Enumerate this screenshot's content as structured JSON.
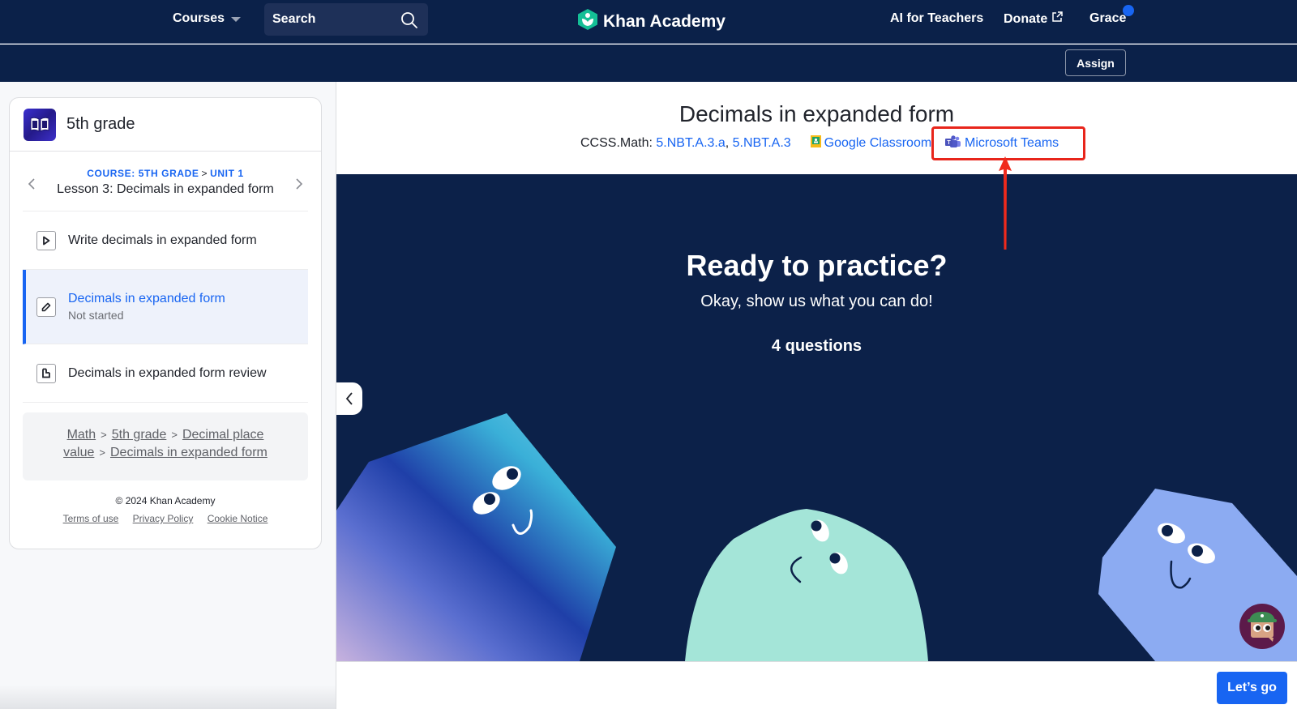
{
  "topnav": {
    "courses_label": "Courses",
    "search_placeholder": "Search",
    "logo_text": "Khan Academy",
    "ai_for_teachers": "AI for Teachers",
    "donate": "Donate",
    "user_name": "Grace",
    "notification_color": "#1865f2"
  },
  "subnav": {
    "assign_label": "Assign"
  },
  "sidebar": {
    "course_title": "5th grade",
    "lesson_crumb": {
      "course": "COURSE: 5TH GRADE",
      "separator": ">",
      "unit": "UNIT 1"
    },
    "lesson_title": "Lesson 3: Decimals in expanded form",
    "items": [
      {
        "label": "Write decimals in expanded form",
        "type": "video",
        "status": ""
      },
      {
        "label": "Decimals in expanded form",
        "type": "exercise",
        "status": "Not started",
        "active": true
      },
      {
        "label": "Decimals in expanded form review",
        "type": "article",
        "status": ""
      }
    ],
    "breadcrumb": [
      "Math",
      "5th grade",
      "Decimal place value",
      "Decimals in expanded form"
    ],
    "breadcrumb_separator": ">",
    "footer": {
      "copyright": "© 2024 Khan Academy",
      "links": [
        "Terms of use",
        "Privacy Policy",
        "Cookie Notice"
      ]
    }
  },
  "main": {
    "exercise_title": "Decimals in expanded form",
    "standards_label": "CCSS.Math:",
    "standards": [
      "5.NBT.A.3.a",
      "5.NBT.A.3"
    ],
    "google_classroom": "Google Classroom",
    "microsoft_teams": "Microsoft Teams",
    "highlight_color": "#e8251b",
    "ready_title": "Ready to practice?",
    "ready_subtitle": "Okay, show us what you can do!",
    "question_count": "4 questions",
    "lets_go": "Let’s go"
  },
  "colors": {
    "nav_bg": "#0b2149",
    "accent": "#1865f2",
    "stage_bg": "#0c2149"
  }
}
